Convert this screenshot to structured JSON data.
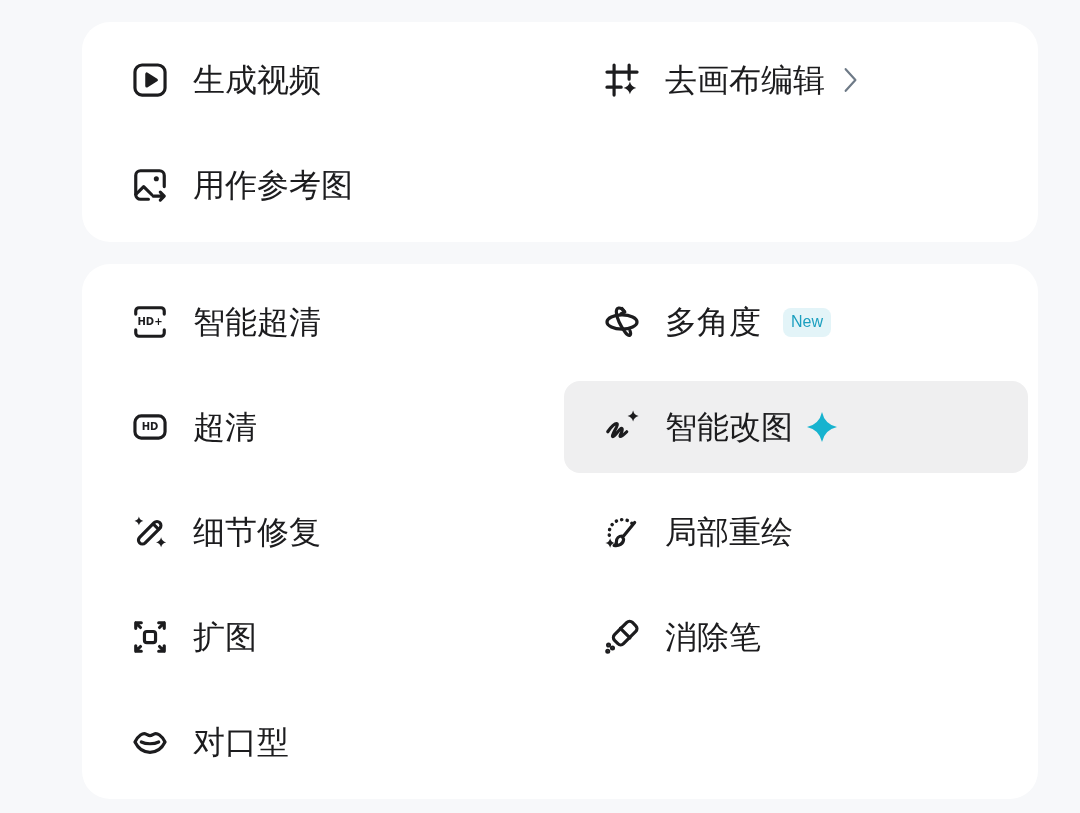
{
  "sections": [
    {
      "items": [
        {
          "label": "生成视频",
          "selected": false,
          "submenu": false,
          "featured": false
        },
        {
          "label": "去画布编辑",
          "selected": false,
          "submenu": true,
          "featured": false
        },
        {
          "label": "用作参考图",
          "selected": false,
          "submenu": false,
          "featured": false
        }
      ]
    },
    {
      "items": [
        {
          "label": "智能超清",
          "icon_text": "HD+",
          "selected": false,
          "submenu": false,
          "featured": false
        },
        {
          "label": "多角度",
          "badge": "New",
          "selected": false,
          "submenu": false,
          "featured": false
        },
        {
          "label": "超清",
          "icon_text": "HD",
          "selected": false,
          "submenu": false,
          "featured": false
        },
        {
          "label": "智能改图",
          "selected": true,
          "submenu": false,
          "featured": true
        },
        {
          "label": "细节修复",
          "selected": false,
          "submenu": false,
          "featured": false
        },
        {
          "label": "局部重绘",
          "selected": false,
          "submenu": false,
          "featured": false
        },
        {
          "label": "扩图",
          "selected": false,
          "submenu": false,
          "featured": false
        },
        {
          "label": "消除笔",
          "selected": false,
          "submenu": false,
          "featured": false
        },
        {
          "label": "对口型",
          "selected": false,
          "submenu": false,
          "featured": false
        }
      ]
    }
  ]
}
